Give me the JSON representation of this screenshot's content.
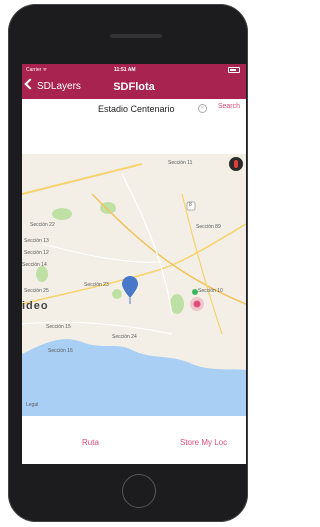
{
  "status_bar": {
    "carrier": "Carrier ᯤ",
    "time": "11:51 AM"
  },
  "nav_bar": {
    "back_label": "SDLayers",
    "title": "SDFlota",
    "color": "#a8234f"
  },
  "search": {
    "value": "Estadio Centenario",
    "search_label": "Search"
  },
  "map": {
    "labels": {
      "seccion11": "Sección 11",
      "seccion22": "Sección 22",
      "seccion13": "Sección 13",
      "seccion12": "Sección 12",
      "seccion14": "Sección 14",
      "seccion25": "Sección 25",
      "seccion23": "Sección 23",
      "seccion10": "Sección 10",
      "seccion89": "Sección 89",
      "seccion15": "Sección 15",
      "seccion24": "Sección 24",
      "seccion16": "Sección 16",
      "city": "ideo",
      "legal": "Legal",
      "route": "8"
    },
    "pin_color": "#4a78c9",
    "user_location_color": "#e24d7a",
    "water_color": "#a9cff4",
    "park_color": "#bfe0a5"
  },
  "bottom": {
    "ruta_label": "Ruta",
    "store_loc_label": "Store My Loc"
  },
  "accent_color": "#e24d7a"
}
